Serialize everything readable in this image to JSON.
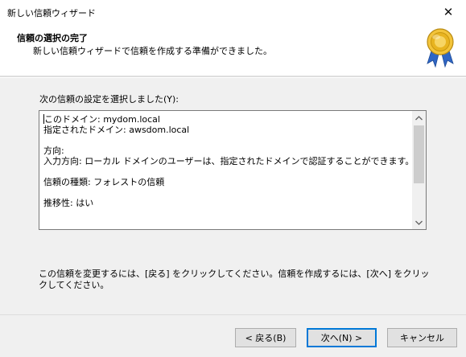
{
  "window": {
    "title": "新しい信頼ウィザード",
    "close_glyph": "✕"
  },
  "header": {
    "title": "信頼の選択の完了",
    "subtitle": "新しい信頼ウィザードで信頼を作成する準備ができました。",
    "icon": "award-medal-icon"
  },
  "main": {
    "selected_label": "次の信頼の設定を選択しました(Y):",
    "summary": {
      "this_domain": "このドメイン: mydom.local",
      "specified_domain": "指定されたドメイン: awsdom.local",
      "direction_heading": "方向:",
      "direction_detail": "入力方向: ローカル ドメインのユーザーは、指定されたドメインで認証することができます。",
      "trust_type": "信頼の種類: フォレストの信頼",
      "transitivity": "推移性: はい"
    },
    "footer_note": "この信頼を変更するには、[戻る] をクリックしてください。信頼を作成するには、[次へ] をクリックしてください。"
  },
  "buttons": {
    "back": "< 戻る(B)",
    "next": "次へ(N) >",
    "cancel": "キャンセル"
  },
  "colors": {
    "accent": "#0078d7",
    "dialog_bg": "#f0f0f0",
    "medal_gold": "#e8b420",
    "ribbon_blue": "#2f66c5"
  }
}
